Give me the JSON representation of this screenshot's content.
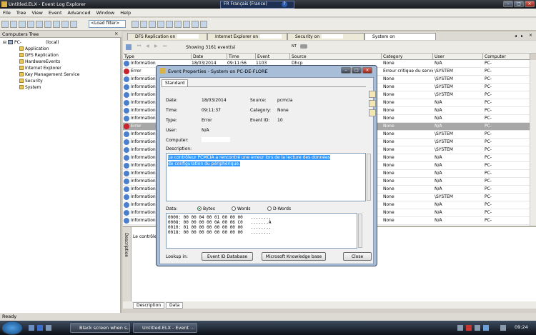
{
  "window": {
    "title": "Untitled.ELX - Event Log Explorer",
    "language": "FR Français (France)",
    "help_glyph": "?"
  },
  "menu": [
    "File",
    "Tree",
    "View",
    "Event",
    "Advanced",
    "Window",
    "Help"
  ],
  "toolbar": {
    "load_filter": "<Load filter>"
  },
  "computers_tree": {
    "header": "Computers Tree",
    "computer": "PC-",
    "computer_suffix": "(local)",
    "logs": [
      "Application",
      "DFS Replication",
      "HardwareEvents",
      "Internet Explorer",
      "Key Management Service",
      "Security",
      "System"
    ]
  },
  "tabs": [
    {
      "label": "DFS Replication on"
    },
    {
      "label": "Internet Explorer on"
    },
    {
      "label": "Security on"
    },
    {
      "label": "System on",
      "active": true
    }
  ],
  "nav": {
    "showing": "Showing 3161 event(s)",
    "nt": "NT"
  },
  "columns": [
    "Type",
    "Date",
    "Time",
    "Event",
    "Source",
    "Category",
    "User",
    "Computer"
  ],
  "rows": [
    {
      "type": "Information",
      "date": "18/03/2014",
      "time": "09:11:56",
      "event": "1103",
      "source": "Dhcp",
      "category": "None",
      "user": "N/A",
      "computer": "PC-"
    },
    {
      "type": "Error",
      "category": "Erreur critique du service",
      "user": "\\SYSTEM",
      "computer": "PC-"
    },
    {
      "type": "Information",
      "category": "None",
      "user": "\\SYSTEM",
      "computer": "PC-"
    },
    {
      "type": "Information",
      "category": "None",
      "user": "\\SYSTEM",
      "computer": "PC-"
    },
    {
      "type": "Information",
      "category": "None",
      "user": "\\SYSTEM",
      "computer": "PC-"
    },
    {
      "type": "Information",
      "category": "None",
      "user": "N/A",
      "computer": "PC-"
    },
    {
      "type": "Information",
      "category": "None",
      "user": "N/A",
      "computer": "PC-"
    },
    {
      "type": "Information",
      "category": "None",
      "user": "N/A",
      "computer": "PC-"
    },
    {
      "type": "Error",
      "category": "None",
      "user": "N/A",
      "computer": "PC-",
      "selected": true
    },
    {
      "type": "Information",
      "category": "None",
      "user": "\\SYSTEM",
      "computer": "PC-"
    },
    {
      "type": "Information",
      "category": "None",
      "user": "\\SYSTEM",
      "computer": "PC-"
    },
    {
      "type": "Information",
      "category": "None",
      "user": "\\SYSTEM",
      "computer": "PC-"
    },
    {
      "type": "Information",
      "category": "None",
      "user": "N/A",
      "computer": "PC-"
    },
    {
      "type": "Information",
      "category": "None",
      "user": "N/A",
      "computer": "PC-"
    },
    {
      "type": "Information",
      "category": "None",
      "user": "N/A",
      "computer": "PC-"
    },
    {
      "type": "Information",
      "category": "None",
      "user": "N/A",
      "computer": "PC-"
    },
    {
      "type": "Information",
      "category": "None",
      "user": "N/A",
      "computer": "PC-"
    },
    {
      "type": "Information",
      "category": "None",
      "user": "\\SYSTEM",
      "computer": "PC-"
    },
    {
      "type": "Information",
      "category": "None",
      "user": "N/A",
      "computer": "PC-"
    },
    {
      "type": "Information",
      "category": "None",
      "user": "N/A",
      "computer": "PC-"
    },
    {
      "type": "Information",
      "category": "None",
      "user": "N/A",
      "computer": "PC-"
    }
  ],
  "description_pane": {
    "label": "Description",
    "text": "Le contrôle",
    "tabs": [
      "Description",
      "Data"
    ]
  },
  "status": "Ready",
  "dialog": {
    "title": "Event Properties - System on PC-DE-FLORE",
    "tab": "Standard",
    "date_label": "Date:",
    "date": "18/03/2014",
    "time_label": "Time:",
    "time": "09:11:37",
    "type_label": "Type:",
    "type": "Error",
    "user_label": "User:",
    "user": "N/A",
    "computer_label": "Computer:",
    "source_label": "Source:",
    "source": "pcmcia",
    "category_label": "Category:",
    "category": "None",
    "eventid_label": "Event ID:",
    "eventid": "10",
    "description_label": "Description:",
    "description": "Le contrôleur PCMCIA a rencontré une erreur lors de la lecture des données de configuration du périphérique.",
    "data_label": "Data:",
    "radio": [
      "Bytes",
      "Words",
      "D-Words"
    ],
    "hex": [
      "0000: 00 00 04 00 01 00 00 00   ........",
      "0008: 00 00 00 00 0A 00 06 C0   .......À",
      "0010: 01 00 00 00 00 00 00 00   ........",
      "0018: 00 00 00 00 00 00 00 00   ........"
    ],
    "lookup_label": "Lookup in:",
    "buttons": [
      "Event ID Database",
      "Microsoft Knowledge base",
      "Close"
    ]
  },
  "taskbar": {
    "items": [
      "Black screen when s...",
      "Untitled.ELX - Event ..."
    ],
    "clock": "09:24"
  }
}
